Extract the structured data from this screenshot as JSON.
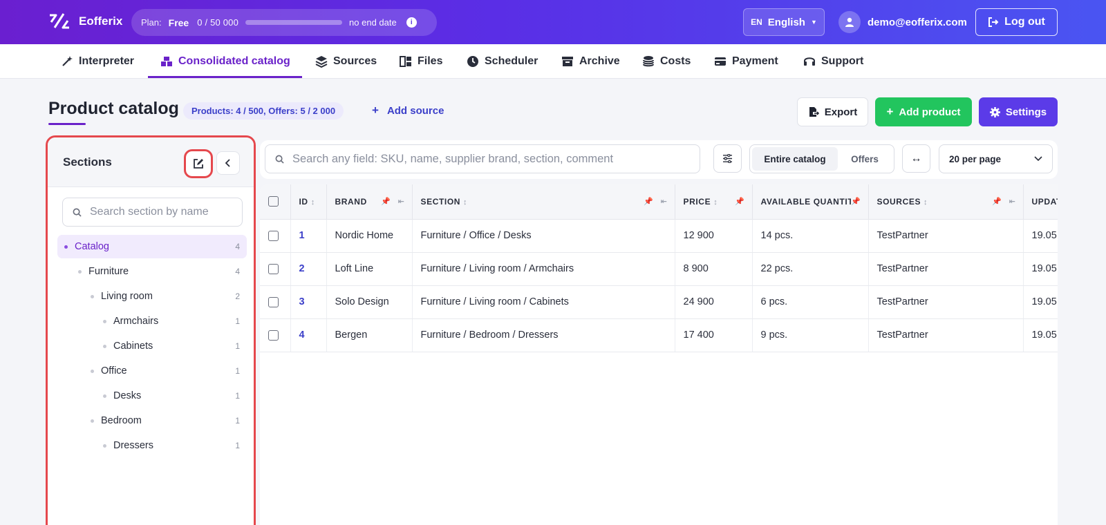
{
  "header": {
    "brand": "Eofferix",
    "plan": {
      "label": "Plan:",
      "tier": "Free",
      "usage": "0  /  50 000",
      "usage_fraction": 0,
      "end": "no end date"
    },
    "language": {
      "code": "EN",
      "name": "English"
    },
    "user_email": "demo@eofferix.com",
    "logout_label": "Log out"
  },
  "nav": [
    {
      "label": "Interpreter",
      "icon": "magic-wand-icon"
    },
    {
      "label": "Consolidated catalog",
      "icon": "catalog-icon",
      "active": true
    },
    {
      "label": "Sources",
      "icon": "layers-icon"
    },
    {
      "label": "Files",
      "icon": "files-icon"
    },
    {
      "label": "Scheduler",
      "icon": "clock-icon"
    },
    {
      "label": "Archive",
      "icon": "archive-icon"
    },
    {
      "label": "Costs",
      "icon": "coins-icon"
    },
    {
      "label": "Payment",
      "icon": "card-icon"
    },
    {
      "label": "Support",
      "icon": "headset-icon"
    }
  ],
  "page": {
    "title": "Product catalog",
    "stats": "Products: 4 / 500, Offers: 5 / 2 000",
    "add_source": "Add source",
    "export": "Export",
    "add_product": "Add product",
    "settings": "Settings"
  },
  "sidebar": {
    "title": "Sections",
    "search_placeholder": "Search section by name",
    "items": [
      {
        "label": "Catalog",
        "count": "4",
        "level": 0,
        "active": true
      },
      {
        "label": "Furniture",
        "count": "4",
        "level": 1
      },
      {
        "label": "Living room",
        "count": "2",
        "level": 2
      },
      {
        "label": "Armchairs",
        "count": "1",
        "level": 3
      },
      {
        "label": "Cabinets",
        "count": "1",
        "level": 3
      },
      {
        "label": "Office",
        "count": "1",
        "level": 2
      },
      {
        "label": "Desks",
        "count": "1",
        "level": 3
      },
      {
        "label": "Bedroom",
        "count": "1",
        "level": 2
      },
      {
        "label": "Dressers",
        "count": "1",
        "level": 3
      }
    ]
  },
  "toolbar": {
    "search_placeholder": "Search any field: SKU, name, supplier brand, section, comment",
    "toggle": [
      "Entire catalog",
      "Offers"
    ],
    "per_page": "20 per page"
  },
  "table": {
    "columns": [
      "ID",
      "BRAND",
      "SECTION",
      "PRICE",
      "AVAILABLE QUANTITY",
      "SOURCES",
      "UPDATED"
    ],
    "rows": [
      [
        "1",
        "Nordic Home",
        "Furniture / Office / Desks",
        "12 900",
        "14 pcs.",
        "TestPartner",
        "19.05"
      ],
      [
        "2",
        "Loft Line",
        "Furniture / Living room / Armchairs",
        "8 900",
        "22 pcs.",
        "TestPartner",
        "19.05"
      ],
      [
        "3",
        "Solo Design",
        "Furniture / Living room / Cabinets",
        "24 900",
        "6 pcs.",
        "TestPartner",
        "19.05"
      ],
      [
        "4",
        "Bergen",
        "Furniture / Bedroom / Dressers",
        "17 400",
        "9 pcs.",
        "TestPartner",
        "19.05"
      ]
    ]
  },
  "colors": {
    "brand_purple": "#6a22c9",
    "green": "#22c55e",
    "settings": "#5b3be8",
    "highlight": "#e5484d"
  }
}
